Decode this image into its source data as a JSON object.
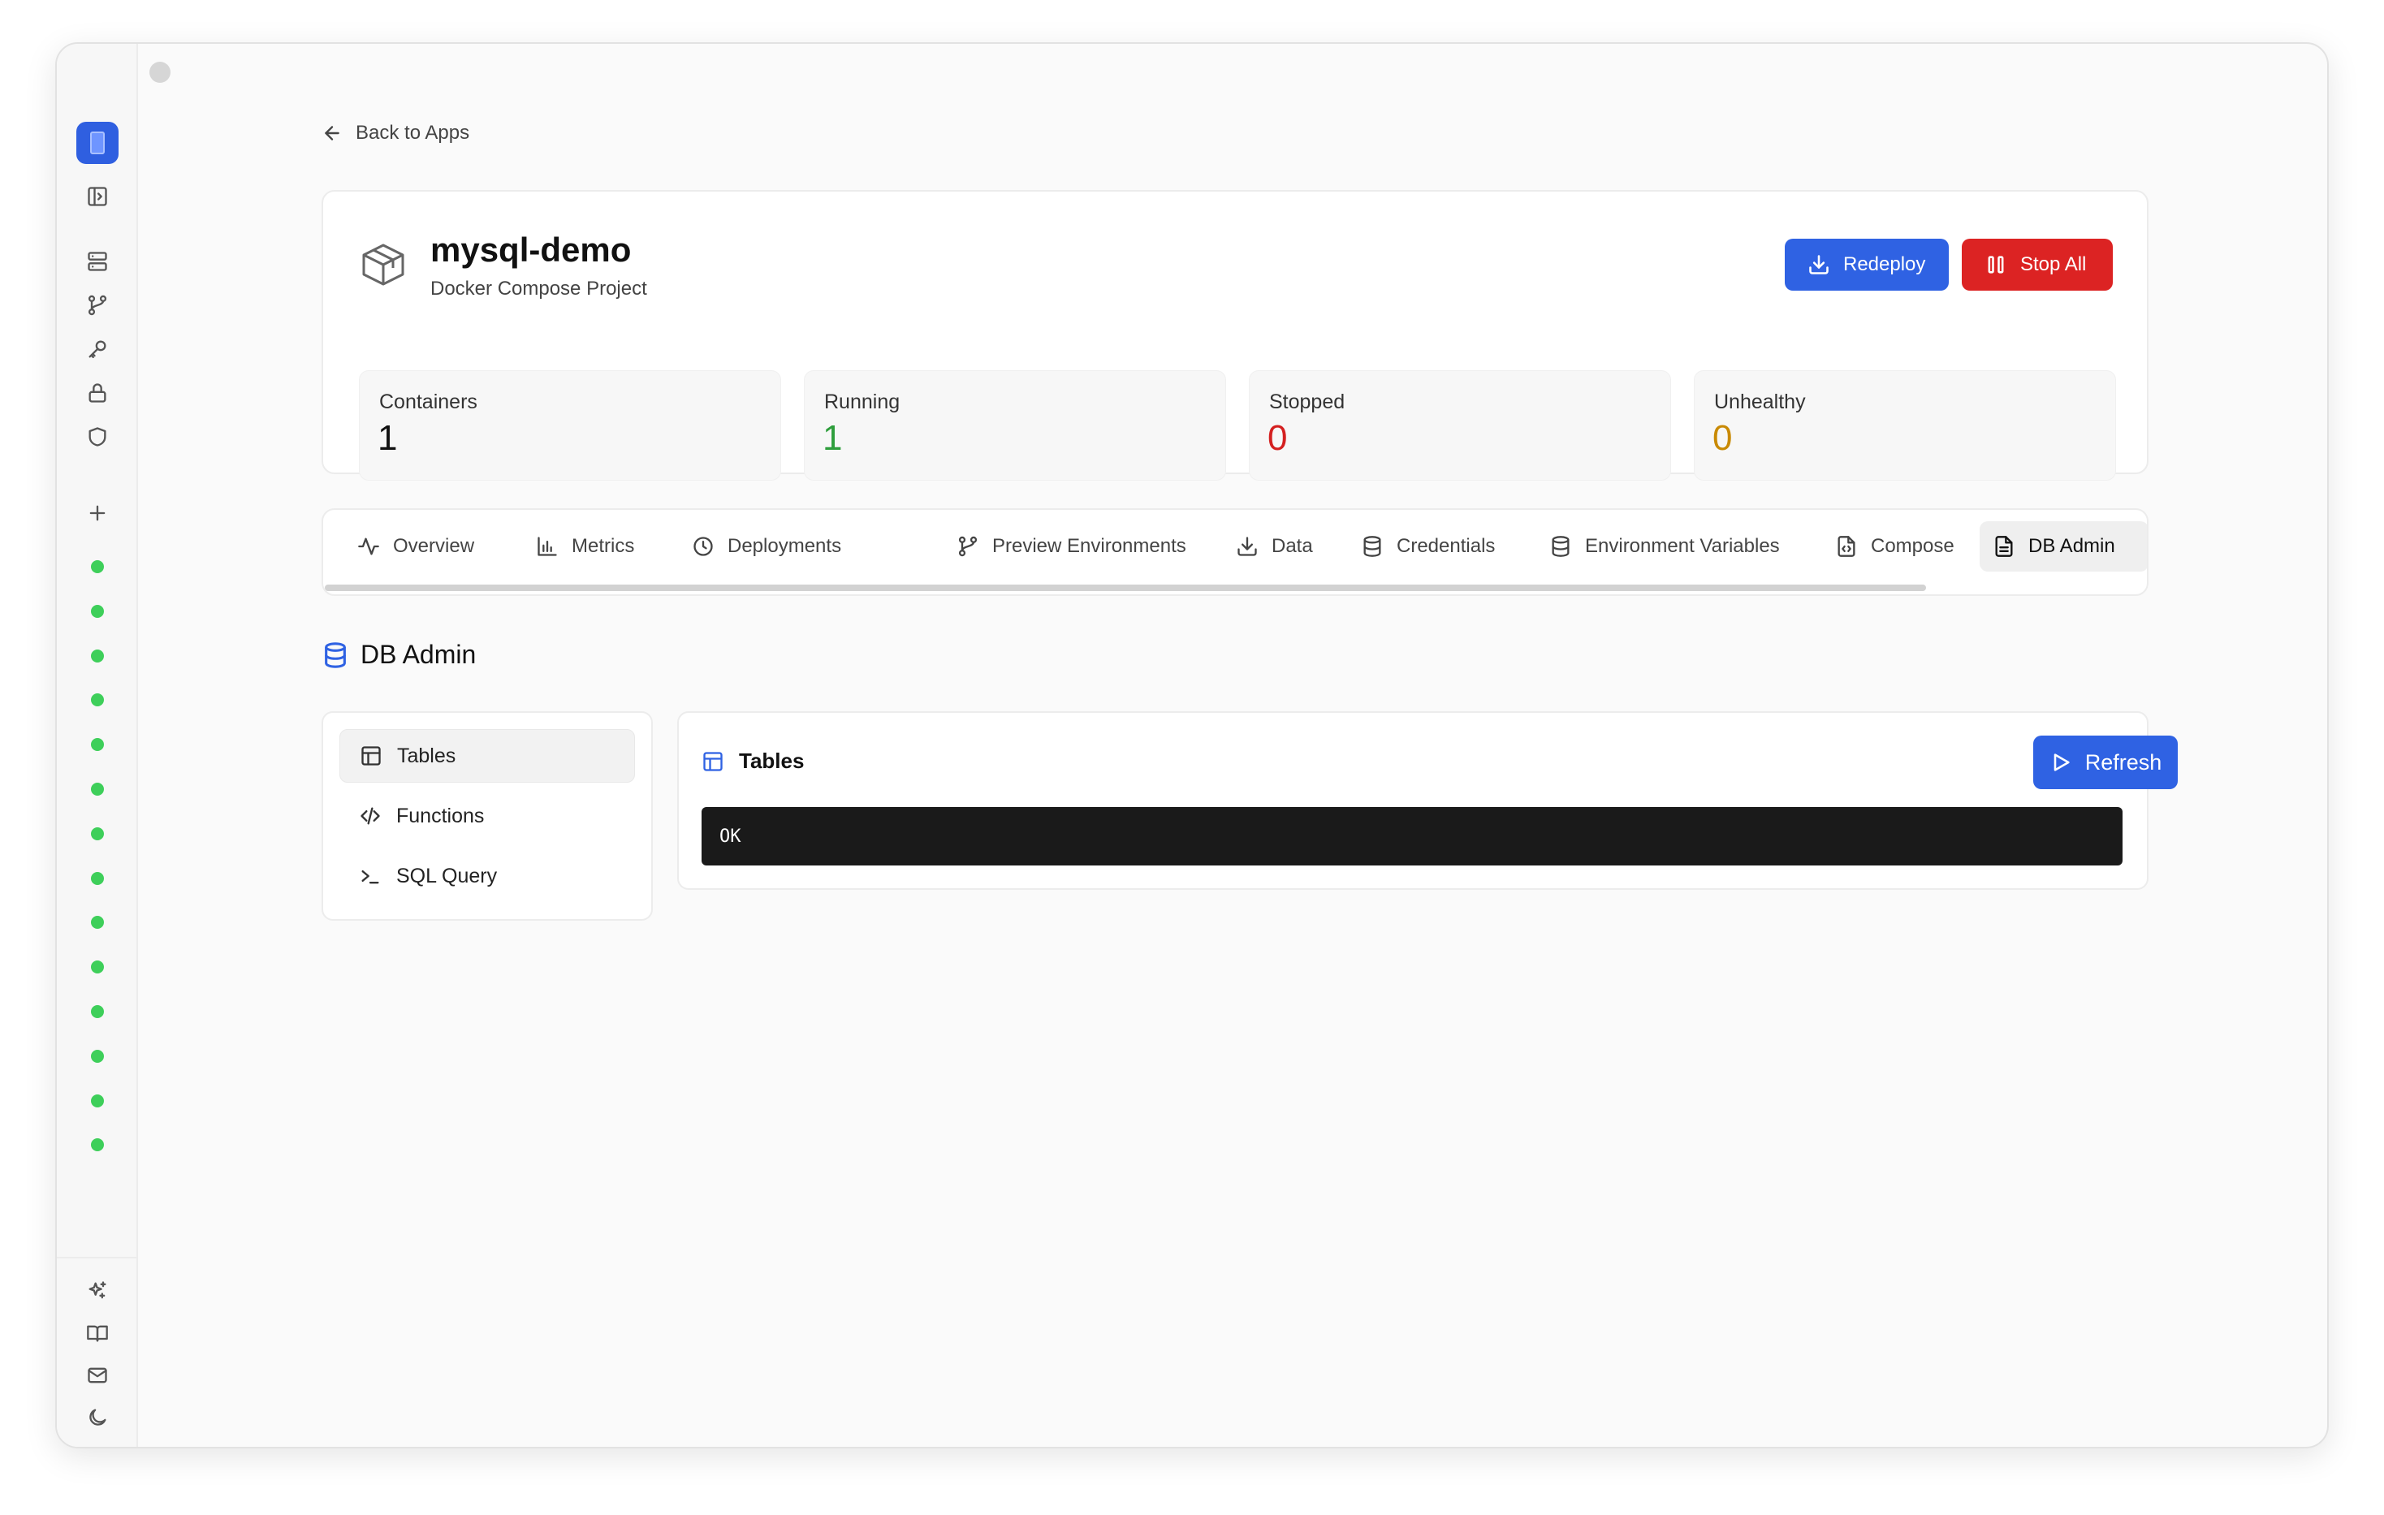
{
  "nav": {
    "back_label": "Back to Apps"
  },
  "app": {
    "name": "mysql-demo",
    "subtitle": "Docker Compose Project",
    "redeploy_label": "Redeploy",
    "stop_label": "Stop All"
  },
  "stats": [
    {
      "label": "Containers",
      "value": "1",
      "color": "#111111"
    },
    {
      "label": "Running",
      "value": "1",
      "color": "#2e9e3c"
    },
    {
      "label": "Stopped",
      "value": "0",
      "color": "#d42020"
    },
    {
      "label": "Unhealthy",
      "value": "0",
      "color": "#c98a05"
    }
  ],
  "tabs": [
    {
      "label": "Overview",
      "icon": "activity-icon"
    },
    {
      "label": "Metrics",
      "icon": "bar-chart-icon"
    },
    {
      "label": "Deployments",
      "icon": "clock-icon"
    },
    {
      "label": "Preview Environments",
      "icon": "git-branch-icon"
    },
    {
      "label": "Data",
      "icon": "download-icon"
    },
    {
      "label": "Credentials",
      "icon": "database-icon"
    },
    {
      "label": "Environment Variables",
      "icon": "database-icon"
    },
    {
      "label": "Compose",
      "icon": "file-code-icon"
    },
    {
      "label": "DB Admin",
      "icon": "file-text-icon",
      "active": true
    }
  ],
  "section": {
    "title": "DB Admin"
  },
  "subnav": [
    {
      "label": "Tables",
      "icon": "table-icon",
      "active": true
    },
    {
      "label": "Functions",
      "icon": "code-icon"
    },
    {
      "label": "SQL Query",
      "icon": "terminal-icon"
    }
  ],
  "panel": {
    "title": "Tables",
    "refresh_label": "Refresh",
    "output": "OK"
  },
  "colors": {
    "accent": "#2f62e3",
    "danger": "#dc2323",
    "status_ok": "#3ecf5a"
  }
}
